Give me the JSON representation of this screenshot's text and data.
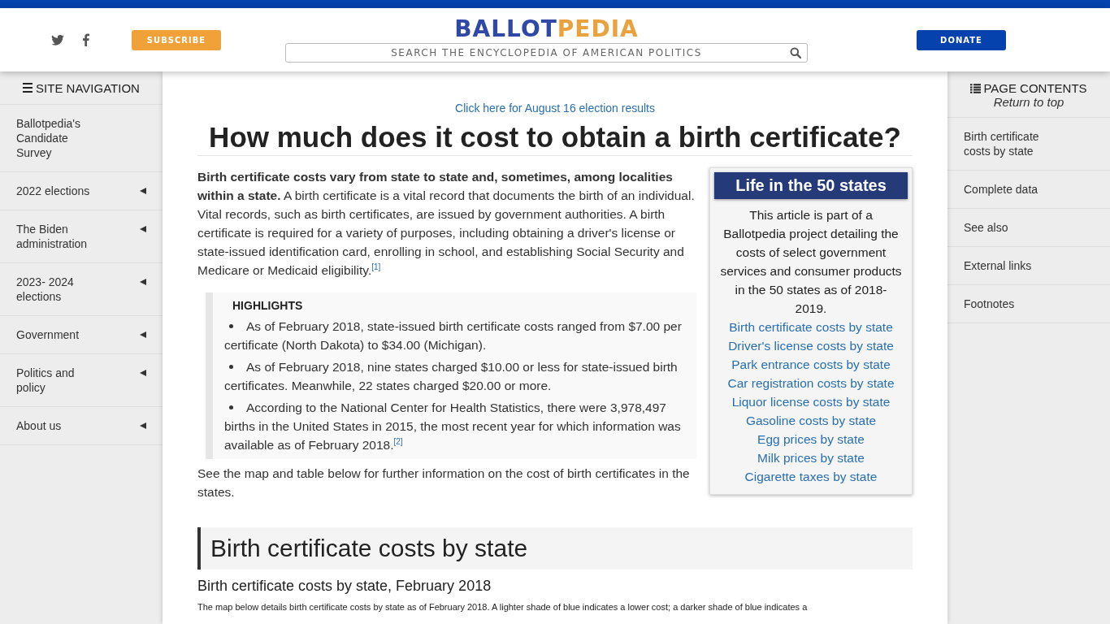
{
  "header": {
    "subscribe_button": "SUBSCRIBE",
    "logo": {
      "first": "BALLOT",
      "second": "PEDIA"
    },
    "search": {
      "placeholder": "SEARCH THE ENCYCLOPEDIA OF AMERICAN POLITICS"
    },
    "donate_button": "DONATE"
  },
  "site_navigation": {
    "title": "SITE NAVIGATION",
    "items": [
      {
        "label": "Ballotpedia's Candidate Survey",
        "has_submenu": false
      },
      {
        "label": "2022 elections",
        "has_submenu": true
      },
      {
        "label": "The Biden administration",
        "has_submenu": true
      },
      {
        "label": "2023- 2024 elections",
        "has_submenu": true
      },
      {
        "label": "Government",
        "has_submenu": true
      },
      {
        "label": "Politics and policy",
        "has_submenu": true
      },
      {
        "label": "About us",
        "has_submenu": true
      }
    ]
  },
  "article": {
    "banner_link": "Click here for August 16 election results",
    "title": "How much does it cost to obtain a birth certificate?",
    "intro": "**Birth certificate costs vary from state to state and, sometimes, among localities within a state.** A birth certificate is a vital record that documents the birth of an individual. Vital records, such as birth certificates, are issued by government authorities. A birth certificate is required for a variety of purposes, including obtaining a driver's license or state-issued identification card, enrolling in school, and establishing Social Security and Medicare or Medicaid eligibility.$^{[1]}$",
    "highlights": {
      "title": "HIGHLIGHTS",
      "items": [
        "As of February 2018, state-issued birth certificate costs ranged from $7.00 per certificate (North Dakota) to $34.00 (Michigan).",
        "As of February 2018, nine states charged $10.00 or less for state-issued birth certificates. Meanwhile, 22 states charged $20.00 or more.",
        "According to the National Center for Health Statistics, there were 3,978,497 births in the United States in 2015, the most recent year for which information was available as of February 2018.$^{[2]}$"
      ]
    },
    "outro": "See the map and table below for further information on the cost of birth certificates in the states.",
    "infobox": {
      "title": "Life in the 50 states",
      "text": "This article is part of a Ballotpedia project detailing the costs of select government services and consumer products in the 50 states as of 2018-2019.",
      "links": [
        "Birth certificate costs by state",
        "Driver's license costs by state",
        "Park entrance costs by state",
        "Car registration costs by state",
        "Liquor license costs by state",
        "Gasoline costs by state",
        "Egg prices by state",
        "Milk prices by state",
        "Cigarette taxes by state"
      ]
    },
    "section_heading": "Birth certificate costs by state",
    "subheading": "Birth certificate costs by state, February 2018",
    "caption": "The map below details birth certificate costs by state as of February 2018. A lighter shade of blue indicates a lower cost; a darker shade of blue indicates a"
  },
  "page_contents": {
    "title": "PAGE CONTENTS",
    "return_link": "Return to top",
    "items": [
      "Birth certificate costs by state",
      "Complete data",
      "See also",
      "External links",
      "Footnotes"
    ]
  }
}
